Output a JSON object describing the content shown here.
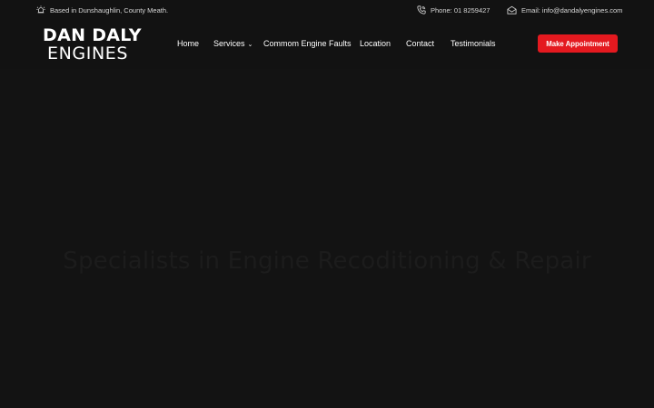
{
  "topbar": {
    "location_text": "Based in Dunshaughlin, County Meath.",
    "phone_text": "Phone: 01 8259427",
    "email_text": "Email: info@dandalyengines.com"
  },
  "logo": {
    "line1": "DAN DALY",
    "line2": "ENGINES"
  },
  "nav": {
    "items": [
      {
        "label": "Home"
      },
      {
        "label": "Services"
      },
      {
        "label": "Commom Engine Faults"
      },
      {
        "label": "Location"
      },
      {
        "label": "Contact"
      },
      {
        "label": "Testimonials"
      }
    ],
    "cta_label": "Make Appointment"
  },
  "hero": {
    "title": "Specialists in Engine Recoditioning & Repair"
  },
  "colors": {
    "background": "#121212",
    "accent": "#e4191f",
    "text": "#ffffff"
  },
  "icons": [
    "alarm-icon",
    "phone-icon",
    "envelope-icon",
    "chevron-down-icon"
  ]
}
